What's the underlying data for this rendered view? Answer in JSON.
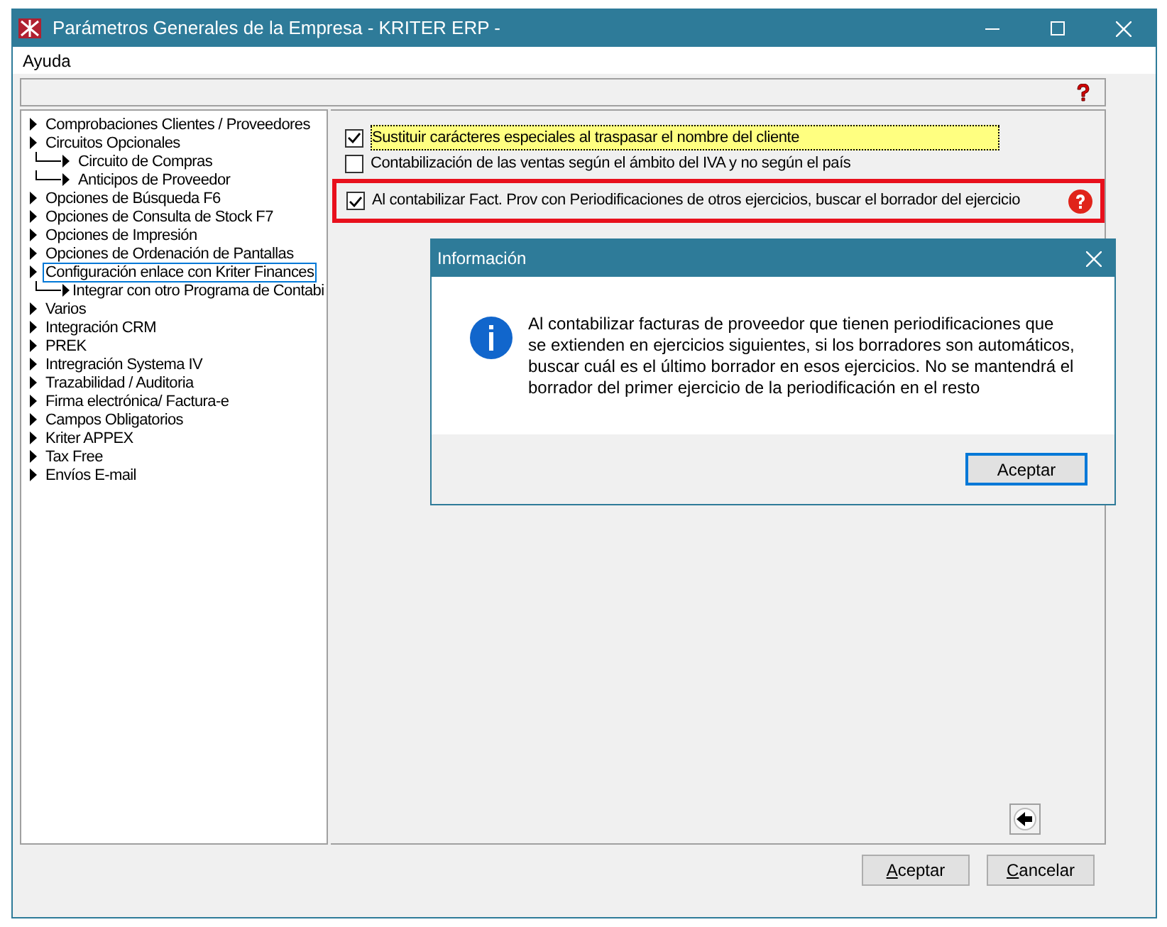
{
  "window": {
    "title": "Parámetros Generales de la Empresa - KRITER ERP -"
  },
  "menu": [
    {
      "label": "Ayuda"
    }
  ],
  "tree": [
    {
      "label": "Comprobaciones Clientes / Proveedores",
      "selected": false
    },
    {
      "label": "Circuitos Opcionales",
      "selected": false,
      "children": [
        {
          "label": "Circuito de Compras",
          "selected": false
        },
        {
          "label": "Anticipos de Proveedor",
          "selected": false
        }
      ]
    },
    {
      "label": "Opciones de Búsqueda F6",
      "selected": false
    },
    {
      "label": "Opciones de Consulta de Stock F7",
      "selected": false
    },
    {
      "label": "Opciones de Impresión",
      "selected": false
    },
    {
      "label": "Opciones de Ordenación de Pantallas",
      "selected": false
    },
    {
      "label": "Configuración enlace con Kriter Finances",
      "selected": true,
      "children": [
        {
          "label": "Integrar con otro Programa de Contabi",
          "selected": false
        }
      ]
    },
    {
      "label": "Varios",
      "selected": false
    },
    {
      "label": "Integración CRM",
      "selected": false
    },
    {
      "label": "PREK",
      "selected": false
    },
    {
      "label": "Intregración Systema IV",
      "selected": false
    },
    {
      "label": "Trazabilidad / Auditoria",
      "selected": false
    },
    {
      "label": "Firma electrónica/ Factura-e",
      "selected": false
    },
    {
      "label": "Campos Obligatorios",
      "selected": false
    },
    {
      "label": "Kriter APPEX",
      "selected": false
    },
    {
      "label": "Tax Free",
      "selected": false
    },
    {
      "label": "Envíos E-mail",
      "selected": false
    }
  ],
  "options": [
    {
      "label": "Sustituir carácteres especiales al traspasar el nombre del cliente",
      "checked": true,
      "highlighted": true,
      "flagged": false
    },
    {
      "label": "Contabilización de las ventas según el ámbito del IVA y no según el país",
      "checked": false,
      "highlighted": false,
      "flagged": false
    },
    {
      "label": "Al contabilizar Fact. Prov con Periodificaciones de otros ejercicios, buscar el borrador del ejercicio",
      "checked": true,
      "highlighted": false,
      "flagged": true
    }
  ],
  "buttons": [
    {
      "label": "Aceptar",
      "mnemonic": true
    },
    {
      "label": "Cancelar",
      "mnemonic": true
    }
  ],
  "dialog": {
    "title": "Información",
    "message": "Al contabilizar facturas de proveedor que tienen periodificaciones que se extienden en ejercicios siguientes, si los borradores son automáticos, buscar cuál es el último borrador en esos ejercicios. No se mantendrá el borrador del primer ejercicio de la periodificación en el resto",
    "button": {
      "label": "Aceptar",
      "mnemonic": false
    }
  }
}
